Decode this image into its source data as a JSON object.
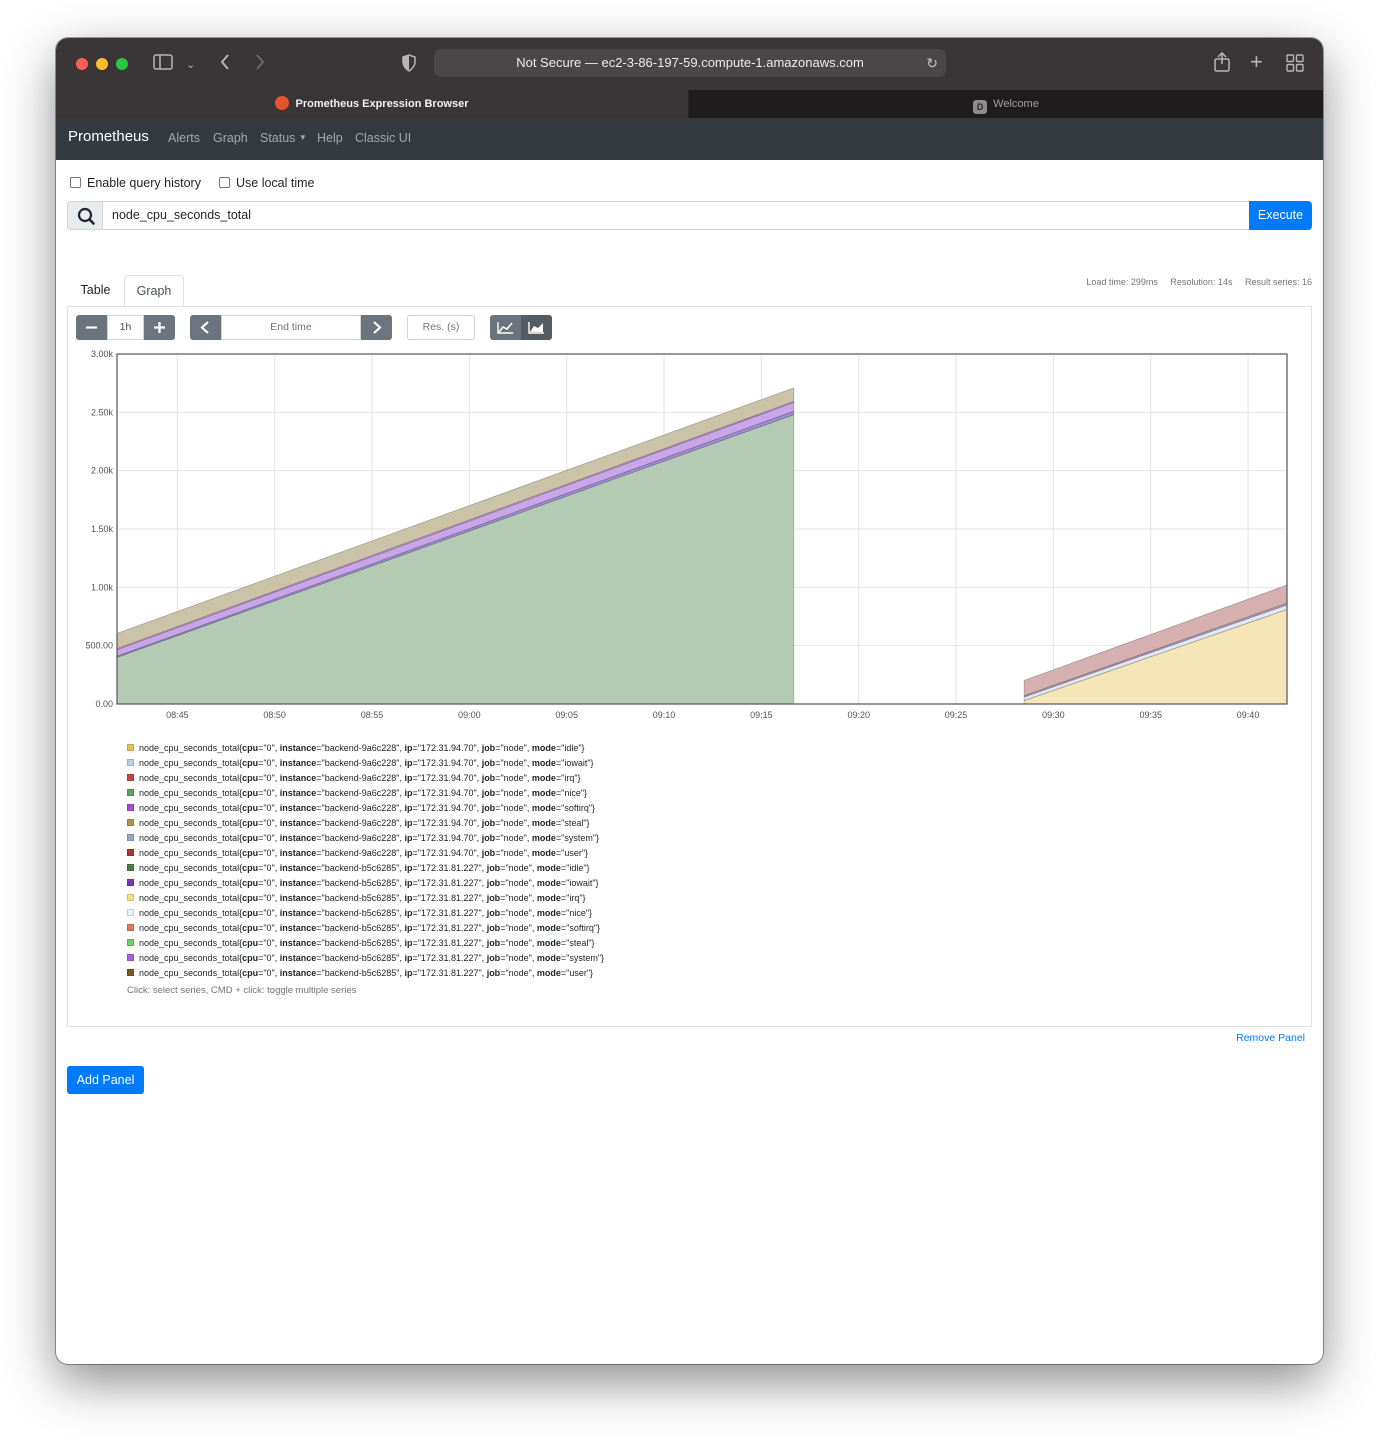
{
  "browser": {
    "url": "Not Secure — ec2-3-86-197-59.compute-1.amazonaws.com",
    "tabs": [
      {
        "label": "Prometheus Expression Browser",
        "active": true
      },
      {
        "label": "Welcome",
        "active": false,
        "favicon_letter": "D"
      }
    ]
  },
  "navbar": {
    "brand": "Prometheus",
    "links": [
      "Alerts",
      "Graph",
      "Status",
      "Help",
      "Classic UI"
    ]
  },
  "options": {
    "query_history_label": "Enable query history",
    "local_time_label": "Use local time"
  },
  "query": {
    "expression": "node_cpu_seconds_total",
    "execute_label": "Execute"
  },
  "panel": {
    "tab_table": "Table",
    "tab_graph": "Graph",
    "load_time": "Load time: 299ms",
    "resolution": "Resolution: 14s",
    "result_series": "Result series: 16",
    "range_value": "1h",
    "end_time_placeholder": "End time",
    "res_placeholder": "Res. (s)",
    "legend_hint": "Click: select series, CMD + click: toggle multiple series",
    "remove_label": "Remove Panel"
  },
  "add_panel_label": "Add Panel",
  "chart_data": {
    "type": "area",
    "stacked": true,
    "xlabel": "",
    "ylabel": "",
    "ylim": [
      0,
      3000
    ],
    "y_ticks": [
      "0.00",
      "500.00",
      "1.00k",
      "1.50k",
      "2.00k",
      "2.50k",
      "3.00k"
    ],
    "x_ticks": [
      "08:45",
      "08:50",
      "08:55",
      "09:00",
      "09:05",
      "09:10",
      "09:15",
      "09:20",
      "09:25",
      "09:30",
      "09:35",
      "09:40"
    ],
    "x_range": [
      "08:41:54",
      "09:42:00"
    ],
    "grid": true,
    "legend_placement": "bottom",
    "series_groups": [
      {
        "instance": "backend-9a6c228",
        "x_start": "08:41:54",
        "x_end": "09:16:40",
        "stack_bottom_to_top": [
          {
            "mode": "idle",
            "color": "#b3cbb3",
            "start": 400,
            "end": 2480
          },
          {
            "mode": "iowait",
            "color": "#9e8ed9",
            "start": 10,
            "end": 30
          },
          {
            "mode": "softirq",
            "color": "#c9a6e8",
            "start": 55,
            "end": 75
          },
          {
            "mode": "system",
            "color": "#e3a8f0",
            "start": 10,
            "end": 10
          },
          {
            "mode": "user",
            "color": "#cbc3a8",
            "start": 130,
            "end": 115
          }
        ]
      },
      {
        "instance": "backend-b5c6285",
        "x_start": "09:28:30",
        "x_end": "09:42:00",
        "stack_bottom_to_top": [
          {
            "mode": "irq",
            "color": "#f5e6b8",
            "start": 30,
            "end": 810
          },
          {
            "mode": "nice",
            "color": "#e0e8f5",
            "start": 30,
            "end": 40
          },
          {
            "mode": "system",
            "color": "#b8a0c0",
            "start": 12,
            "end": 15
          },
          {
            "mode": "user",
            "color": "#d6b0b0",
            "start": 130,
            "end": 155
          }
        ]
      }
    ],
    "legend": [
      {
        "instance": "backend-9a6c228",
        "ip": "172.31.94.70",
        "mode": "idle",
        "color": "#e8c05a"
      },
      {
        "instance": "backend-9a6c228",
        "ip": "172.31.94.70",
        "mode": "iowait",
        "color": "#b8d2ec"
      },
      {
        "instance": "backend-9a6c228",
        "ip": "172.31.94.70",
        "mode": "irq",
        "color": "#c9443c"
      },
      {
        "instance": "backend-9a6c228",
        "ip": "172.31.94.70",
        "mode": "nice",
        "color": "#5ba35b"
      },
      {
        "instance": "backend-9a6c228",
        "ip": "172.31.94.70",
        "mode": "softirq",
        "color": "#a54fd6"
      },
      {
        "instance": "backend-9a6c228",
        "ip": "172.31.94.70",
        "mode": "steal",
        "color": "#b8924a"
      },
      {
        "instance": "backend-9a6c228",
        "ip": "172.31.94.70",
        "mode": "system",
        "color": "#94a9c9"
      },
      {
        "instance": "backend-9a6c228",
        "ip": "172.31.94.70",
        "mode": "user",
        "color": "#a03c30"
      },
      {
        "instance": "backend-b5c6285",
        "ip": "172.31.81.227",
        "mode": "idle",
        "color": "#4c7f45"
      },
      {
        "instance": "backend-b5c6285",
        "ip": "172.31.81.227",
        "mode": "iowait",
        "color": "#7438c0"
      },
      {
        "instance": "backend-b5c6285",
        "ip": "172.31.81.227",
        "mode": "irq",
        "color": "#f4e27a"
      },
      {
        "instance": "backend-b5c6285",
        "ip": "172.31.81.227",
        "mode": "nice",
        "color": "#e4f4f8"
      },
      {
        "instance": "backend-b5c6285",
        "ip": "172.31.81.227",
        "mode": "softirq",
        "color": "#e07a60"
      },
      {
        "instance": "backend-b5c6285",
        "ip": "172.31.81.227",
        "mode": "steal",
        "color": "#6fcf66"
      },
      {
        "instance": "backend-b5c6285",
        "ip": "172.31.81.227",
        "mode": "system",
        "color": "#a65ee6"
      },
      {
        "instance": "backend-b5c6285",
        "ip": "172.31.81.227",
        "mode": "user",
        "color": "#7a5a24"
      }
    ]
  }
}
